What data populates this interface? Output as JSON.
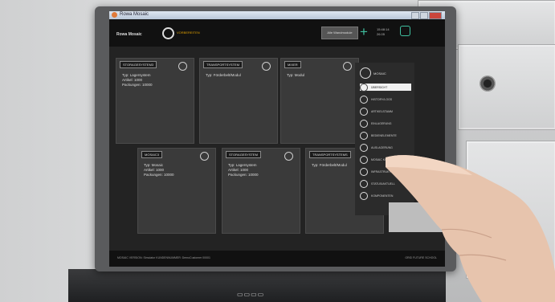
{
  "window": {
    "title": "Rowa Mosaic"
  },
  "header": {
    "brand": "Rowa Mosaic",
    "logo_sub": "VORBEREITEN",
    "all_button": "Alle Wandmodule",
    "clock_line1": "15:48:14",
    "clock_line2": "26.05"
  },
  "cards": [
    {
      "tag": "STORAGESYSTEM3",
      "lines": [
        "Typ: Lagersystem",
        "Artikel: 1000",
        "Packungen: 10000"
      ]
    },
    {
      "tag": "TRANSPORTSYSTEM",
      "lines": [
        "Typ: Förderbelt/Modul"
      ]
    },
    {
      "tag": "MIXER",
      "lines": [
        "Typ: Modul"
      ]
    },
    {
      "tag": "MOSAIC3",
      "lines": [
        "Typ: Mosaic",
        "Artikel: 1000",
        "Packungen: 10000"
      ]
    },
    {
      "tag": "STORAGESYSTEM",
      "lines": [
        "Typ: Lagersystem",
        "Artikel: 1000",
        "Packungen: 10000"
      ]
    },
    {
      "tag": "TRANSPORTSYSTEMS",
      "lines": [
        "Typ: Förderbelt/Modul"
      ]
    }
  ],
  "side": {
    "title": "MOSAIC",
    "items": [
      "ÜBERSICHT",
      "HISTORY/LOGS",
      "ARTIKELSTAMM",
      "EINLAGERUNG",
      "BEDIENELEMENTE",
      "AUSLAGERUNG",
      "MOSAIC KONFIGURATION",
      "INFRASTRUKTUR",
      "STATUS/AKTUELL",
      "KOMPONENTEN"
    ]
  },
  "footer": {
    "left": "MOSAIC VERSION: Simulator   KUNDENNUMMER: DemoCustomer   00001",
    "right": "GRID FUTURE SCHOOL"
  },
  "badge": "▭▭▭▭"
}
